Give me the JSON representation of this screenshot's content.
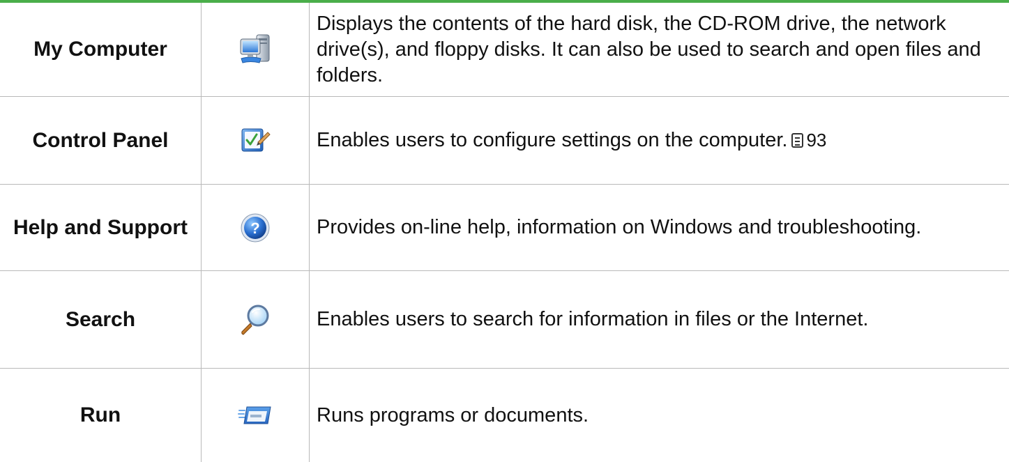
{
  "rows": [
    {
      "name": "My Computer",
      "icon": "my-computer-icon",
      "description": "Displays the contents of the hard disk, the CD-ROM drive, the network drive(s), and floppy disks. It can also be used to search and open files and folders."
    },
    {
      "name": "Control Panel",
      "icon": "control-panel-icon",
      "description": "Enables users to configure settings on the computer.",
      "page_ref": "93"
    },
    {
      "name": "Help and Support",
      "icon": "help-icon",
      "description": "Provides on-line help, information on Windows and troubleshooting."
    },
    {
      "name": "Search",
      "icon": "search-icon",
      "description": "Enables users to search for information in files or the Internet."
    },
    {
      "name": "Run",
      "icon": "run-icon",
      "description": "Runs programs or documents."
    }
  ],
  "colors": {
    "top_rule": "#4aae4a",
    "grid_line": "#b9b9b9"
  }
}
